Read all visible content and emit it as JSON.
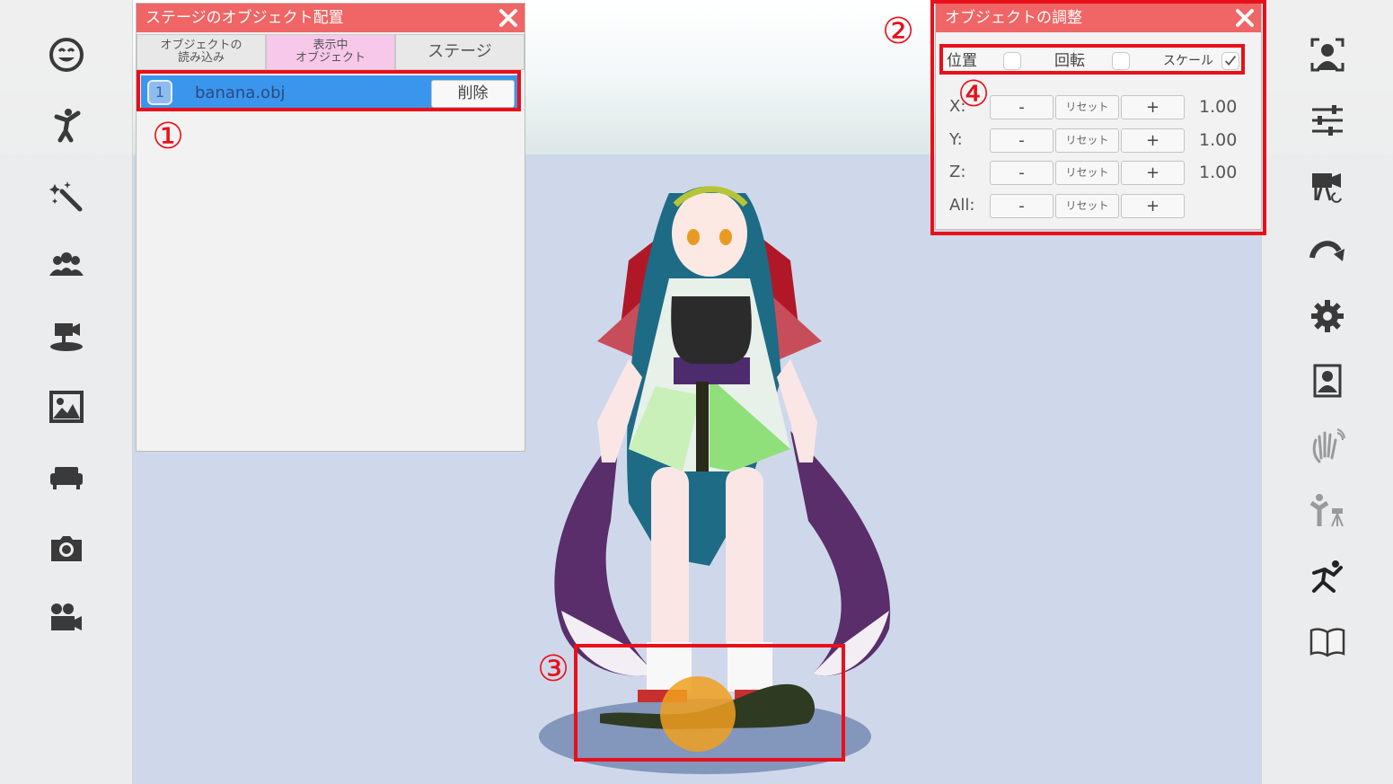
{
  "left_toolbar": {
    "items": [
      {
        "icon": "smiley-face-icon"
      },
      {
        "icon": "pose-figure-icon"
      },
      {
        "icon": "magic-wand-icon"
      },
      {
        "icon": "group-people-icon"
      },
      {
        "icon": "stage-camera-icon"
      },
      {
        "icon": "image-icon"
      },
      {
        "icon": "sofa-icon"
      },
      {
        "icon": "camera-icon"
      },
      {
        "icon": "video-camera-icon"
      }
    ]
  },
  "right_toolbar": {
    "items": [
      {
        "icon": "face-tracking-icon"
      },
      {
        "icon": "sliders-icon"
      },
      {
        "icon": "camera-switch-icon"
      },
      {
        "icon": "redo-arrow-icon"
      },
      {
        "icon": "gear-icon"
      },
      {
        "icon": "portrait-icon"
      },
      {
        "icon": "hand-wave-icon"
      },
      {
        "icon": "figure-tripod-icon"
      },
      {
        "icon": "dance-figure-icon"
      },
      {
        "icon": "book-icon"
      }
    ]
  },
  "object_panel": {
    "title": "ステージのオブジェクト配置",
    "tabs": [
      {
        "label_line1": "オブジェクトの",
        "label_line2": "読み込み"
      },
      {
        "label_line1": "表示中",
        "label_line2": "オブジェクト"
      },
      {
        "label": "ステージ"
      }
    ],
    "active_tab": 1,
    "items": [
      {
        "index": "1",
        "name": "banana.obj",
        "delete_label": "削除"
      }
    ]
  },
  "adjust_panel": {
    "title": "オブジェクトの調整",
    "modes": [
      {
        "label": "位置",
        "checked": false
      },
      {
        "label": "回転",
        "checked": false
      },
      {
        "label": "スケール",
        "checked": true
      }
    ],
    "minus_label": "-",
    "reset_label": "リセット",
    "plus_label": "+",
    "rows": [
      {
        "axis": "X:",
        "value": "1.00"
      },
      {
        "axis": "Y:",
        "value": "1.00"
      },
      {
        "axis": "Z:",
        "value": "1.00"
      },
      {
        "axis": "All:",
        "value": ""
      }
    ]
  },
  "annotations": {
    "one": "①",
    "two": "②",
    "three": "③",
    "four": "④"
  },
  "colors": {
    "panel_header": "#f06565",
    "selected_row": "#3a96ec",
    "active_tab": "#f7c8ea",
    "annotation_red": "#e8101a",
    "object_orange": "#f0a020"
  }
}
